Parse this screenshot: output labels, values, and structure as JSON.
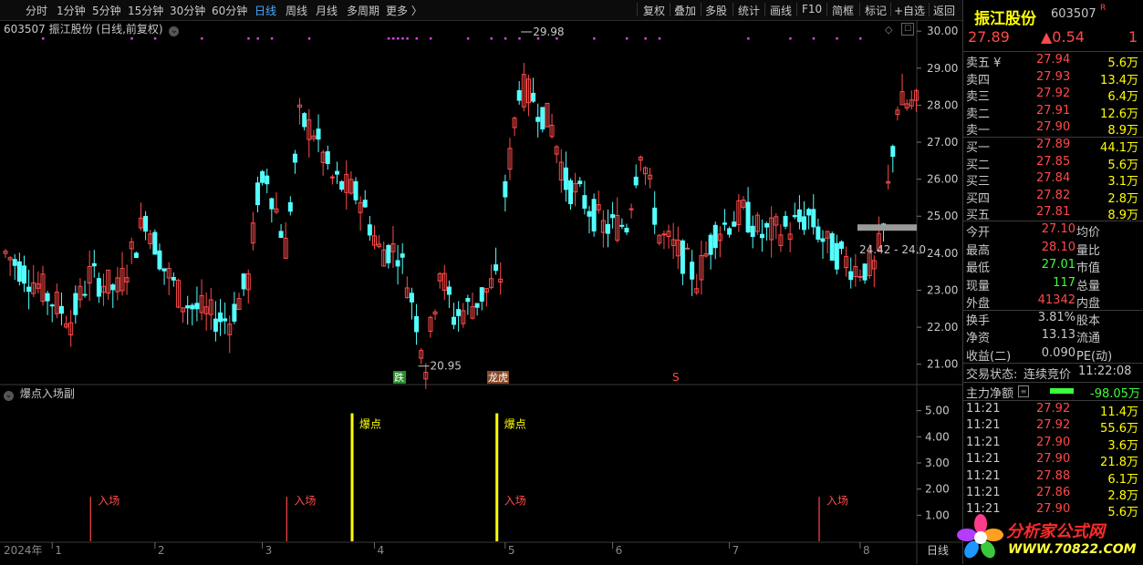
{
  "toolbar": {
    "periods": [
      "分时",
      "1分钟",
      "5分钟",
      "15分钟",
      "30分钟",
      "60分钟",
      "日线",
      "周线",
      "月线",
      "多周期",
      "更多 〉"
    ],
    "active_period": "日线",
    "tools": [
      "复权",
      "叠加",
      "多股",
      "统计",
      "画线",
      "F10",
      "简框",
      "标记",
      "+自选",
      "返回"
    ]
  },
  "chart_title": "603507 振江股份 (日线,前复权)",
  "indicator_title": "爆点入场副",
  "price_axis": [
    "30.00",
    "29.00",
    "28.00",
    "27.00",
    "26.00",
    "25.00",
    "24.00",
    "23.00",
    "22.00",
    "21.00"
  ],
  "indicator_axis": [
    "5.00",
    "4.00",
    "3.00",
    "2.00",
    "1.00"
  ],
  "date_axis": {
    "year": "2024年",
    "months": [
      "1",
      "2",
      "3",
      "4",
      "5",
      "6",
      "7",
      "8"
    ],
    "period_label": "日线"
  },
  "annotations": {
    "high": "29.98",
    "low": "20.95",
    "last_range": "24.42 - 24.0",
    "marker_die": "跌",
    "marker_list": "龙虎",
    "marker_s": "S",
    "signal_boom": "爆点",
    "signal_entry": "入场"
  },
  "colors": {
    "up": "#ff4a4a",
    "down": "#54ffff",
    "magenta": "#e43ce4",
    "yellow": "#ffff00",
    "accent_blue": "#4aa8ff"
  },
  "chart_data": {
    "type": "candlestick",
    "ylim": [
      20.5,
      30.3
    ],
    "signals": {
      "boom_bars": [
        75,
        106
      ],
      "entry_bars": [
        19,
        61,
        106,
        175
      ]
    }
  },
  "quote": {
    "name": "振江股份",
    "code": "603507",
    "flag": "R",
    "price": "27.89",
    "change": "▲0.54",
    "change_pct": "1",
    "asks": [
      {
        "label": "卖五 ¥",
        "price": "27.94",
        "vol": "5.6万"
      },
      {
        "label": "卖四",
        "price": "27.93",
        "vol": "13.4万"
      },
      {
        "label": "卖三",
        "price": "27.92",
        "vol": "6.4万"
      },
      {
        "label": "卖二",
        "price": "27.91",
        "vol": "12.6万"
      },
      {
        "label": "卖一",
        "price": "27.90",
        "vol": "8.9万"
      }
    ],
    "bids": [
      {
        "label": "买一",
        "price": "27.89",
        "vol": "44.1万"
      },
      {
        "label": "买二",
        "price": "27.85",
        "vol": "5.6万"
      },
      {
        "label": "买三",
        "price": "27.84",
        "vol": "3.1万"
      },
      {
        "label": "买四",
        "price": "27.82",
        "vol": "2.8万"
      },
      {
        "label": "买五",
        "price": "27.81",
        "vol": "8.9万"
      }
    ],
    "stats": [
      {
        "label": "今开",
        "value": "27.10",
        "label2": "均价",
        "color": "#ff4a4a"
      },
      {
        "label": "最高",
        "value": "28.10",
        "label2": "量比",
        "color": "#ff4a4a"
      },
      {
        "label": "最低",
        "value": "27.01",
        "label2": "市值",
        "color": "#3cff3c"
      },
      {
        "label": "现量",
        "value": "117",
        "label2": "总量",
        "color": "#3cff3c"
      },
      {
        "label": "外盘",
        "value": "41342",
        "label2": "内盘",
        "color": "#ff4a4a"
      }
    ],
    "stats2": [
      {
        "label": "换手",
        "value": "3.81%",
        "label2": "股本"
      },
      {
        "label": "净资",
        "value": "13.13",
        "label2": "流通"
      },
      {
        "label": "收益(二)",
        "value": "0.090",
        "label2": "PE(动)"
      }
    ],
    "trade_state_label": "交易状态:",
    "trade_state": "连续竞价",
    "trade_time": "11:22:08",
    "main_flow_label": "主力净额",
    "main_flow_value": "-98.05万",
    "ticks": [
      {
        "time": "11:21",
        "price": "27.92",
        "vol": "11.4万"
      },
      {
        "time": "11:21",
        "price": "27.92",
        "vol": "55.6万"
      },
      {
        "time": "11:21",
        "price": "27.90",
        "vol": "3.6万"
      },
      {
        "time": "11:21",
        "price": "27.90",
        "vol": "21.8万"
      },
      {
        "time": "11:21",
        "price": "27.88",
        "vol": "6.1万"
      },
      {
        "time": "11:21",
        "price": "27.86",
        "vol": "2.8万"
      },
      {
        "time": "11:21",
        "price": "27.90",
        "vol": "5.6万"
      }
    ]
  },
  "watermark": {
    "name": "分析家公式网",
    "url": "WWW.70822.COM"
  }
}
